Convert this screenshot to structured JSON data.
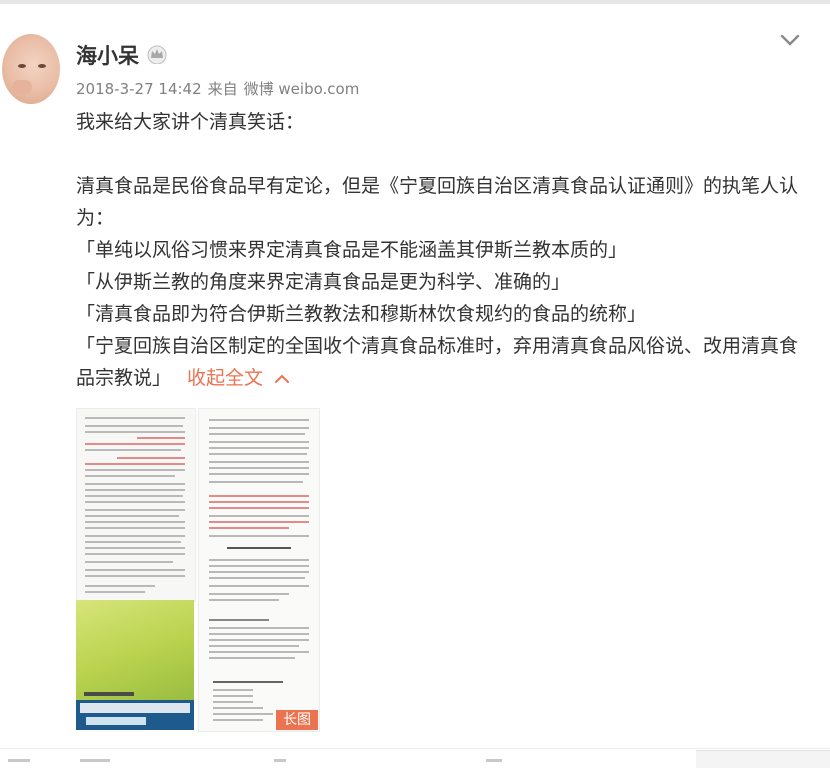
{
  "post": {
    "username": "海小呆",
    "timestamp": "2018-3-27 14:42",
    "source_prefix": "来自",
    "source_name": "微博 weibo.com",
    "paragraphs": [
      "我来给大家讲个清真笑话：",
      "",
      "清真食品是民俗食品早有定论，但是《宁夏回族自治区清真食品认证通则》的执笔人认为：",
      "「单纯以风俗习惯来界定清真食品是不能涵盖其伊斯兰教本质的」",
      "「从伊斯兰教的角度来界定清真食品是更为科学、准确的」",
      "「清真食品即为符合伊斯兰教教法和穆斯林饮食规约的食品的统称」"
    ],
    "last_paragraph": "「宁夏回族自治区制定的全国收个清真食品标准时，弃用清真食品风俗说、改用清真食品宗教说」",
    "collapse_label": "收起全文",
    "image_badge": "长图"
  },
  "icons": {
    "vip": "crown-icon",
    "menu": "chevron-down-icon",
    "collapse": "chevron-up-icon"
  },
  "colors": {
    "accent": "#eb7350",
    "meta_text": "#808080",
    "body_text": "#333333"
  }
}
